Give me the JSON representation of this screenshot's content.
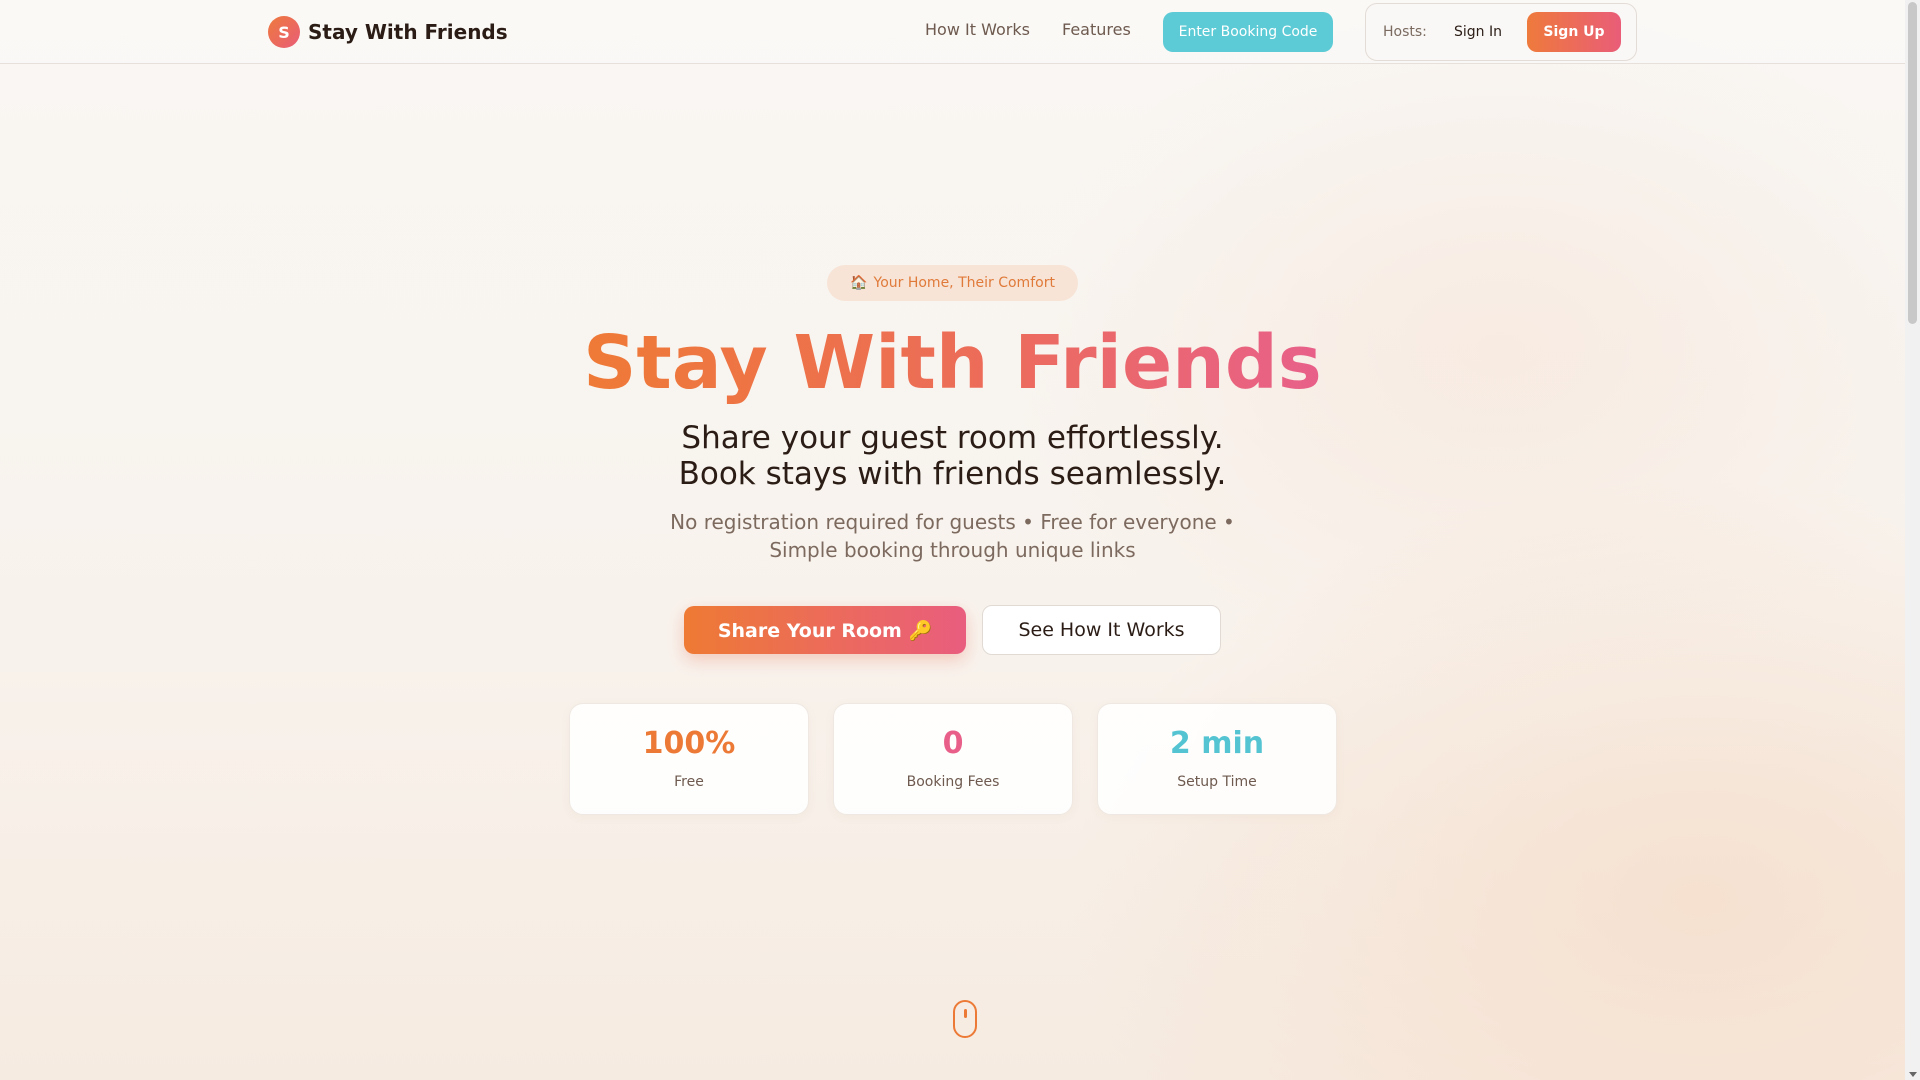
{
  "header": {
    "brand_initial": "S",
    "brand_name": "Stay With Friends",
    "nav": {
      "how_it_works": "How It Works",
      "features": "Features"
    },
    "booking_code_button": "Enter Booking Code",
    "hosts_label": "Hosts:",
    "sign_in": "Sign In",
    "sign_up": "Sign Up"
  },
  "hero": {
    "pill_icon": "house-icon",
    "pill_emoji": "🏠",
    "pill_text": "Your Home, Their Comfort",
    "title": "Stay With Friends",
    "subtitle": "Share your guest room effortlessly. Book stays with friends seamlessly.",
    "description": "No registration required for guests • Free for everyone • Simple booking through unique links",
    "primary_cta": "Share Your Room 🔑",
    "secondary_cta": "See How It Works"
  },
  "stats": [
    {
      "value": "100%",
      "label": "Free",
      "color": "#ec7a36"
    },
    {
      "value": "0",
      "label": "Booking Fees",
      "color": "#e8608a"
    },
    {
      "value": "2 min",
      "label": "Setup Time",
      "color": "#55c4d2"
    }
  ],
  "colors": {
    "accent_orange": "#ee7a3c",
    "accent_pink": "#e95d78",
    "accent_teal": "#5ccbd6",
    "text_dark": "#2b1d16",
    "text_muted": "#7d6a5f"
  }
}
